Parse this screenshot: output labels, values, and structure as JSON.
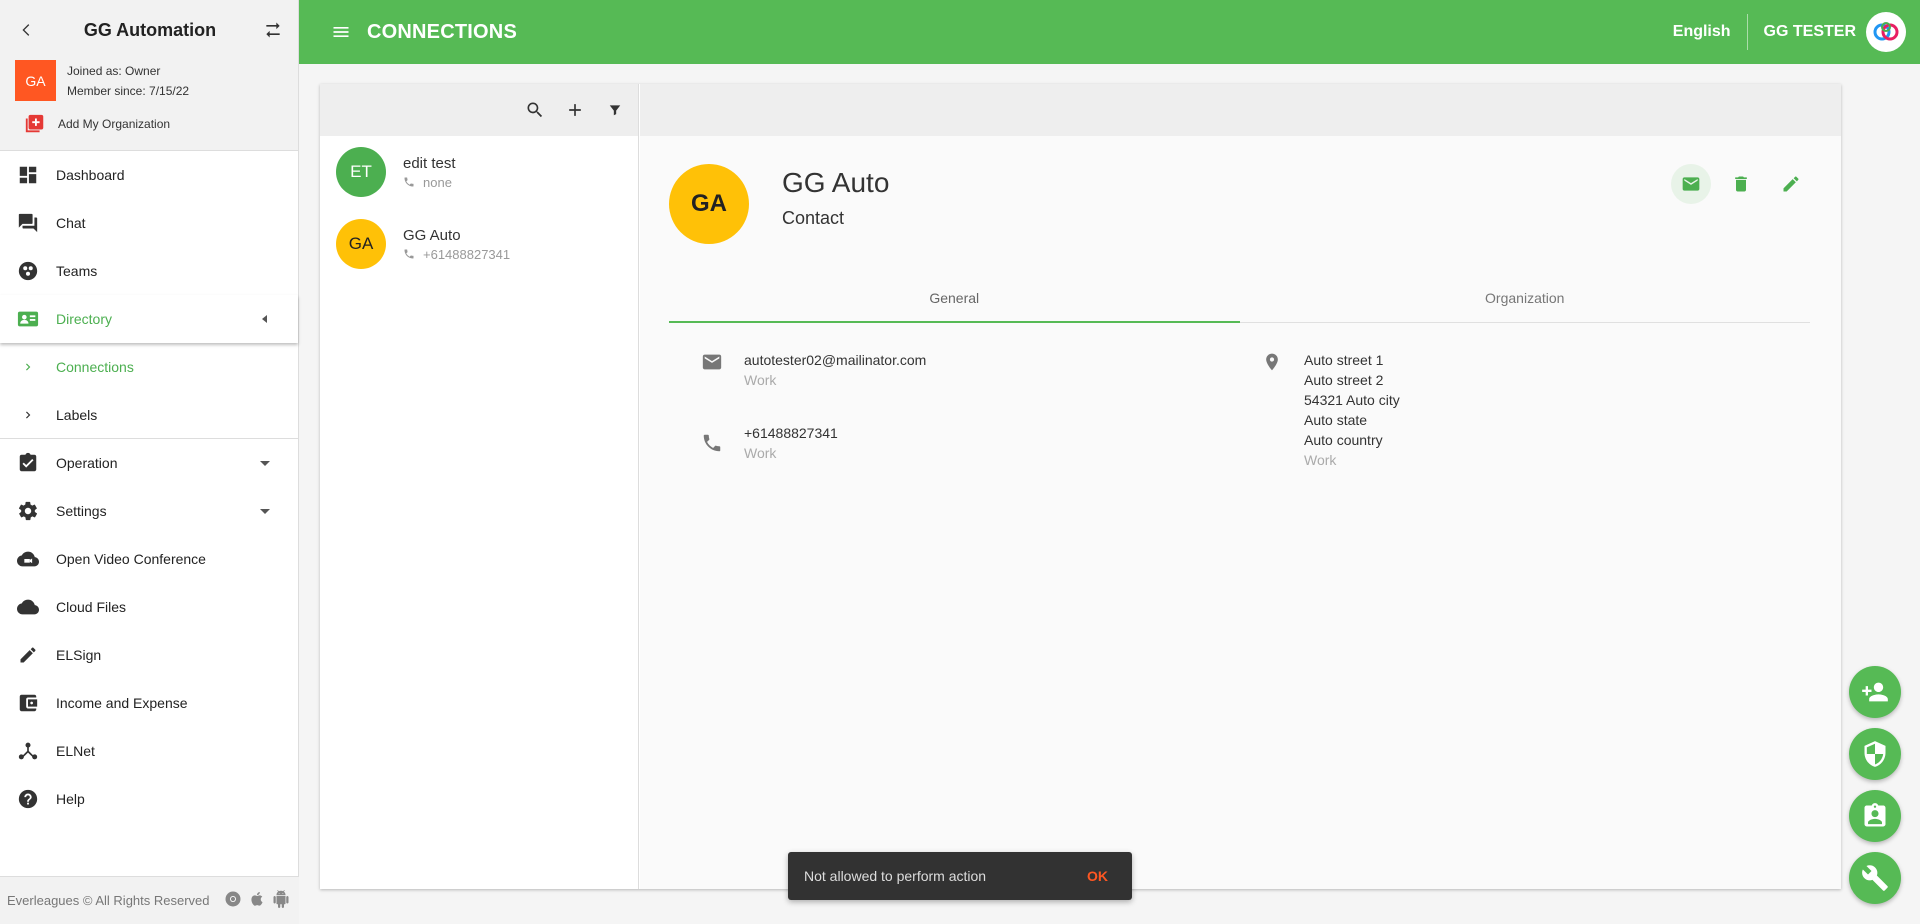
{
  "sidebar": {
    "org_title": "GG Automation",
    "org_avatar": "GA",
    "joined": "Joined as: Owner",
    "member_since": "Member since: 7/15/22",
    "add_org": "Add My Organization",
    "items": [
      {
        "label": "Dashboard",
        "icon": "dashboard-icon"
      },
      {
        "label": "Chat",
        "icon": "chat-icon"
      },
      {
        "label": "Teams",
        "icon": "teams-icon"
      },
      {
        "label": "Directory",
        "icon": "directory-icon"
      },
      {
        "label": "Connections",
        "icon": "chevron-right-icon"
      },
      {
        "label": "Labels",
        "icon": "chevron-right-icon"
      },
      {
        "label": "Operation",
        "icon": "clipboard-check-icon"
      },
      {
        "label": "Settings",
        "icon": "gear-icon"
      },
      {
        "label": "Open Video Conference",
        "icon": "video-cloud-icon"
      },
      {
        "label": "Cloud Files",
        "icon": "cloud-icon"
      },
      {
        "label": "ELSign",
        "icon": "pen-icon"
      },
      {
        "label": "Income and Expense",
        "icon": "wallet-icon"
      },
      {
        "label": "ELNet",
        "icon": "network-icon"
      },
      {
        "label": "Help",
        "icon": "help-icon"
      }
    ],
    "footer": "Everleagues © All Rights Reserved"
  },
  "topbar": {
    "title": "CONNECTIONS",
    "language": "English",
    "user": "GG TESTER"
  },
  "contacts": [
    {
      "initials": "ET",
      "name": "edit test",
      "phone": "none",
      "color": "#4caf50"
    },
    {
      "initials": "GA",
      "name": "GG Auto",
      "phone": "+61488827341",
      "color": "#ffc107"
    }
  ],
  "detail": {
    "initials": "GA",
    "name": "GG Auto",
    "type": "Contact",
    "tabs": [
      "General",
      "Organization"
    ],
    "email": {
      "value": "autotester02@mailinator.com",
      "label": "Work"
    },
    "phone": {
      "value": "+61488827341",
      "label": "Work"
    },
    "address": {
      "lines": [
        "Auto street 1",
        "Auto street 2",
        "54321 Auto city",
        "Auto state",
        "Auto country"
      ],
      "label": "Work"
    }
  },
  "snackbar": {
    "message": "Not allowed to perform action",
    "action": "OK"
  },
  "colors": {
    "primary": "#56ba55",
    "accent": "#ff5722"
  }
}
